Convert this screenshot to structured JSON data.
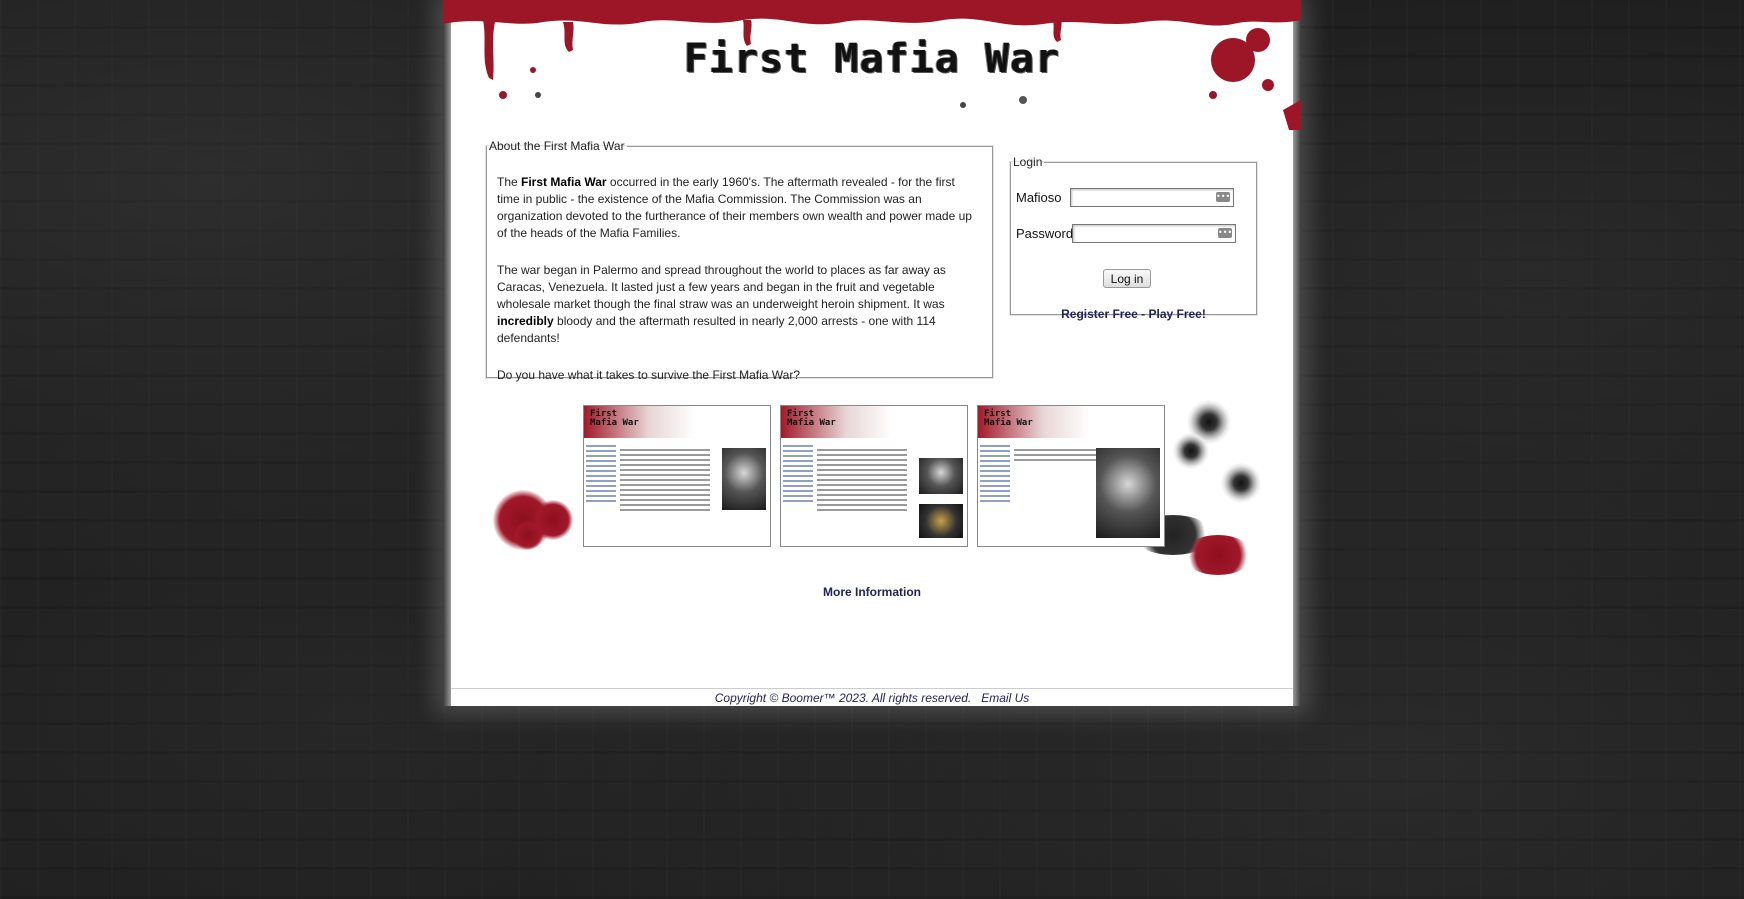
{
  "site": {
    "logo_text": "First Mafia War"
  },
  "about": {
    "legend": "About the First Mafia War",
    "p1_prefix": "The ",
    "p1_bold": "First Mafia War",
    "p1_rest": " occurred in the early 1960's. The aftermath revealed - for the first time in public - the existence of the Mafia Commission. The Commission was an organization devoted to the furtherance of their members own wealth and power made up of the heads of the Mafia Families.",
    "p2_prefix": "The war began in Palermo and spread throughout the world to places as far away as Caracas, Venezuela. It lasted just a few years and began in the fruit and vegetable wholesale market though the final straw was an underweight heroin shipment. It was ",
    "p2_bold": "incredibly",
    "p2_rest": " bloody and the aftermath resulted in nearly 2,000 arrests - one with 114 defendants!",
    "p3": "Do you have what it takes to survive the First Mafia War?"
  },
  "login": {
    "legend": "Login",
    "username_label": "Mafioso",
    "password_label": "Password",
    "username_value": "",
    "password_value": "",
    "field_key_icon": "key-icon",
    "submit_label": "Log in",
    "register_link": "Register Free - Play Free!"
  },
  "screenshots": [
    {
      "name": "screenshot-1",
      "logo_text": "First Mafia War"
    },
    {
      "name": "screenshot-2",
      "logo_text": "First Mafia War"
    },
    {
      "name": "screenshot-3",
      "logo_text": "First Mafia War"
    }
  ],
  "more_info_link": "More Information",
  "footer": {
    "copyright": "Copyright © Boomer™ 2023. All rights reserved.",
    "email_link": "Email Us"
  },
  "colors": {
    "blood_red": "#a0182a",
    "link_navy": "#22225c",
    "page_bg": "#ffffff",
    "outer_bg": "#1c1c1c"
  }
}
